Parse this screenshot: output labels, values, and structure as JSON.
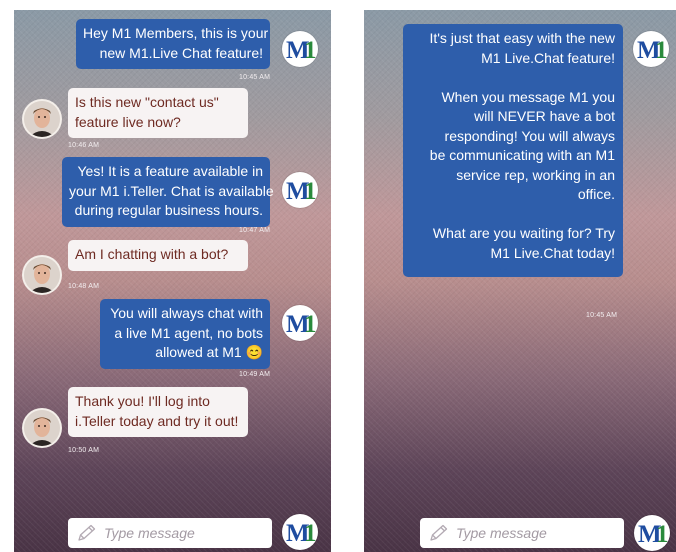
{
  "left_screen": {
    "messages": [
      {
        "lines": [
          "Hey M1 Members, this is your",
          "new M1.Live Chat feature!"
        ],
        "time": "10:45 AM"
      },
      {
        "lines": [
          "Is this new \"contact us\"",
          "feature live now?"
        ],
        "time": "10:46 AM"
      },
      {
        "lines": [
          "Yes! It is a feature available in",
          "your M1 i.Teller. Chat is available",
          "during regular business hours."
        ],
        "time": "10:47 AM"
      },
      {
        "lines": [
          "Am I chatting with a bot?"
        ],
        "time": "10:48 AM"
      },
      {
        "lines": [
          "You will always chat with",
          "a live M1 agent, no bots",
          "allowed at M1 😊"
        ],
        "time": "10:49 AM"
      },
      {
        "lines": [
          "Thank you! I'll log into",
          "i.Teller today and try it out!"
        ],
        "time": "10:50 AM"
      }
    ],
    "input_placeholder": "Type message"
  },
  "right_screen": {
    "paragraphs": [
      [
        "It's just that easy with the new",
        "M1 Live.Chat feature!"
      ],
      [
        "When you message M1 you",
        "will NEVER have a bot",
        "responding! You will always",
        "be communicating with an M1",
        "service rep, working in an",
        "office."
      ],
      [
        "What are you waiting for? Try",
        "M1 Live.Chat today!"
      ]
    ],
    "time": "10:45 AM",
    "input_placeholder": "Type message"
  },
  "logo": {
    "text": "M1",
    "m_color": "#1f4da0",
    "one_color": "#2a8a3c"
  },
  "colors": {
    "agent_bubble": "#2e5eab",
    "member_bubble": "#f7f3f3",
    "member_text": "#6e2a22"
  },
  "icons": {
    "input": "pencil-icon"
  }
}
